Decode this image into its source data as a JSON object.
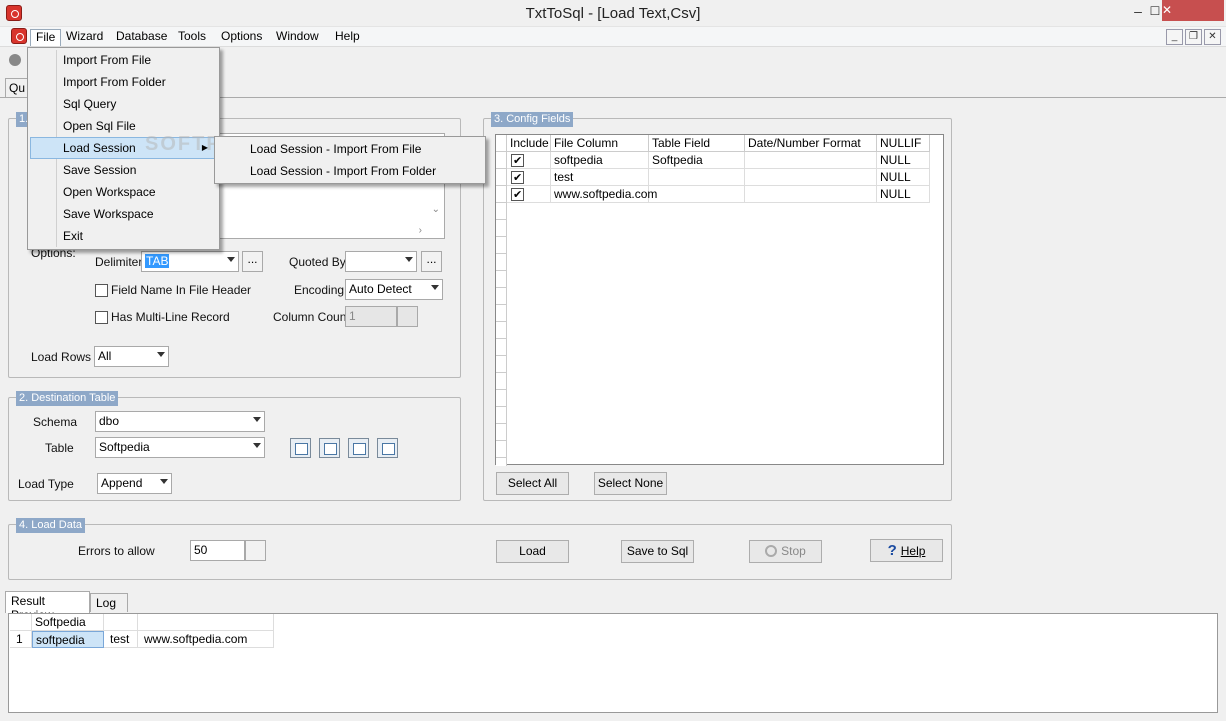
{
  "window": {
    "title": "TxtToSql - [Load Text,Csv]",
    "minimize": "–",
    "maximize": "☐",
    "close": "✕"
  },
  "menubar": {
    "items": [
      "File",
      "Wizard",
      "Database",
      "Tools",
      "Options",
      "Window",
      "Help"
    ]
  },
  "mdi": {
    "minimize": "_",
    "restore": "❐",
    "close": "✕"
  },
  "tab_partial": "Qu",
  "file_menu": {
    "items": [
      "Import From File",
      "Import From Folder",
      "Sql Query",
      "Open Sql File",
      "Load Session",
      "Save Session",
      "Open Workspace",
      "Save Workspace",
      "Exit"
    ],
    "highlighted": "Load Session",
    "submenu": [
      "Load Session - Import From File",
      "Load Session - Import From Folder"
    ]
  },
  "watermark": "SOFTPEDIA",
  "source": {
    "title": "1.",
    "options_label": "Options:",
    "delimiter_label": "Delimiter",
    "delimiter_value": "TAB",
    "quoted_by_label": "Quoted By",
    "quoted_by_value": "",
    "field_name_header_label": "Field Name In File Header",
    "encoding_label": "Encoding",
    "encoding_value": "Auto Detect",
    "multiline_label": "Has Multi-Line Record",
    "column_count_label": "Column Count",
    "column_count_value": "1",
    "load_rows_label": "Load Rows",
    "load_rows_value": "All",
    "ellipsis": "..."
  },
  "destination": {
    "title": "2. Destination Table",
    "schema_label": "Schema",
    "schema_value": "dbo",
    "table_label": "Table",
    "table_value": "Softpedia",
    "load_type_label": "Load Type",
    "load_type_value": "Append"
  },
  "config": {
    "title": "3. Config Fields",
    "columns": [
      "Include",
      "File Column",
      "Table Field",
      "Date/Number Format",
      "NULLIF"
    ],
    "rows": [
      {
        "include": true,
        "file_column": "softpedia",
        "table_field": "Softpedia",
        "format": "",
        "nullif": "NULL"
      },
      {
        "include": true,
        "file_column": "test",
        "table_field": "",
        "format": "",
        "nullif": "NULL"
      },
      {
        "include": true,
        "file_column": "www.softpedia.com",
        "table_field": "",
        "format": "",
        "nullif": "NULL"
      }
    ],
    "select_all": "Select All",
    "select_none": "Select None"
  },
  "load_data": {
    "title": "4. Load Data",
    "errors_label": "Errors to allow",
    "errors_value": "50",
    "load": "Load",
    "save_to_sql": "Save to Sql",
    "stop": "Stop",
    "help": "Help"
  },
  "bottom_tabs": [
    "Result Preview",
    "Log"
  ],
  "result": {
    "header": [
      "Softpedia",
      "",
      ""
    ],
    "row_index": "1",
    "row": [
      "softpedia",
      "test",
      "www.softpedia.com"
    ]
  },
  "colors": {
    "group_title": "#8ea8c8",
    "menu_highlight": "#cde4f7",
    "close_button": "#c74f4f"
  }
}
